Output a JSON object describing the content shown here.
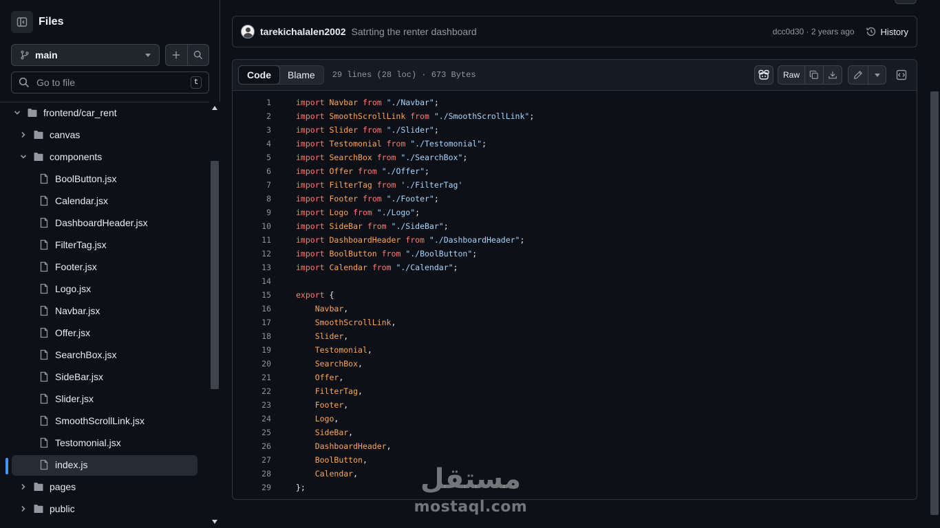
{
  "sidebar": {
    "title": "Files",
    "branch": "main",
    "search_placeholder": "Go to file",
    "shortcut_key": "t",
    "tree": [
      {
        "label": "frontend/car_rent",
        "type": "folder",
        "expanded": true,
        "depth": 0
      },
      {
        "label": "canvas",
        "type": "folder",
        "expanded": false,
        "depth": 1
      },
      {
        "label": "components",
        "type": "folder",
        "expanded": true,
        "depth": 1
      },
      {
        "label": "BoolButton.jsx",
        "type": "file",
        "depth": 2
      },
      {
        "label": "Calendar.jsx",
        "type": "file",
        "depth": 2
      },
      {
        "label": "DashboardHeader.jsx",
        "type": "file",
        "depth": 2
      },
      {
        "label": "FilterTag.jsx",
        "type": "file",
        "depth": 2
      },
      {
        "label": "Footer.jsx",
        "type": "file",
        "depth": 2
      },
      {
        "label": "Logo.jsx",
        "type": "file",
        "depth": 2
      },
      {
        "label": "Navbar.jsx",
        "type": "file",
        "depth": 2
      },
      {
        "label": "Offer.jsx",
        "type": "file",
        "depth": 2
      },
      {
        "label": "SearchBox.jsx",
        "type": "file",
        "depth": 2
      },
      {
        "label": "SideBar.jsx",
        "type": "file",
        "depth": 2
      },
      {
        "label": "Slider.jsx",
        "type": "file",
        "depth": 2
      },
      {
        "label": "SmoothScrollLink.jsx",
        "type": "file",
        "depth": 2
      },
      {
        "label": "Testomonial.jsx",
        "type": "file",
        "depth": 2
      },
      {
        "label": "index.js",
        "type": "file",
        "depth": 2,
        "active": true
      },
      {
        "label": "pages",
        "type": "folder",
        "expanded": false,
        "depth": 1
      },
      {
        "label": "public",
        "type": "folder",
        "expanded": false,
        "depth": 1
      }
    ]
  },
  "commit": {
    "author": "tarekichalalen2002",
    "message": "Satrting the renter dashboard",
    "meta": "dcc0d30 · 2 years ago",
    "history_label": "History"
  },
  "file": {
    "tab_code": "Code",
    "tab_blame": "Blame",
    "info": "29 lines (28 loc) · 673 Bytes",
    "raw_label": "Raw"
  },
  "code_lines": [
    [
      [
        "kw",
        "import"
      ],
      [
        "t",
        " "
      ],
      [
        "id",
        "Navbar"
      ],
      [
        "t",
        " "
      ],
      [
        "kw",
        "from"
      ],
      [
        "t",
        " "
      ],
      [
        "str",
        "\"./Navbar\""
      ],
      [
        "t",
        ";"
      ]
    ],
    [
      [
        "kw",
        "import"
      ],
      [
        "t",
        " "
      ],
      [
        "id",
        "SmoothScrollLink"
      ],
      [
        "t",
        " "
      ],
      [
        "kw",
        "from"
      ],
      [
        "t",
        " "
      ],
      [
        "str",
        "\"./SmoothScrollLink\""
      ],
      [
        "t",
        ";"
      ]
    ],
    [
      [
        "kw",
        "import"
      ],
      [
        "t",
        " "
      ],
      [
        "id",
        "Slider"
      ],
      [
        "t",
        " "
      ],
      [
        "kw",
        "from"
      ],
      [
        "t",
        " "
      ],
      [
        "str",
        "\"./Slider\""
      ],
      [
        "t",
        ";"
      ]
    ],
    [
      [
        "kw",
        "import"
      ],
      [
        "t",
        " "
      ],
      [
        "id",
        "Testomonial"
      ],
      [
        "t",
        " "
      ],
      [
        "kw",
        "from"
      ],
      [
        "t",
        " "
      ],
      [
        "str",
        "\"./Testomonial\""
      ],
      [
        "t",
        ";"
      ]
    ],
    [
      [
        "kw",
        "import"
      ],
      [
        "t",
        " "
      ],
      [
        "id",
        "SearchBox"
      ],
      [
        "t",
        " "
      ],
      [
        "kw",
        "from"
      ],
      [
        "t",
        " "
      ],
      [
        "str",
        "\"./SearchBox\""
      ],
      [
        "t",
        ";"
      ]
    ],
    [
      [
        "kw",
        "import"
      ],
      [
        "t",
        " "
      ],
      [
        "id",
        "Offer"
      ],
      [
        "t",
        " "
      ],
      [
        "kw",
        "from"
      ],
      [
        "t",
        " "
      ],
      [
        "str",
        "\"./Offer\""
      ],
      [
        "t",
        ";"
      ]
    ],
    [
      [
        "kw",
        "import"
      ],
      [
        "t",
        " "
      ],
      [
        "id",
        "FilterTag"
      ],
      [
        "t",
        " "
      ],
      [
        "kw",
        "from"
      ],
      [
        "t",
        " "
      ],
      [
        "str",
        "'./FilterTag'"
      ]
    ],
    [
      [
        "kw",
        "import"
      ],
      [
        "t",
        " "
      ],
      [
        "id",
        "Footer"
      ],
      [
        "t",
        " "
      ],
      [
        "kw",
        "from"
      ],
      [
        "t",
        " "
      ],
      [
        "str",
        "\"./Footer\""
      ],
      [
        "t",
        ";"
      ]
    ],
    [
      [
        "kw",
        "import"
      ],
      [
        "t",
        " "
      ],
      [
        "id",
        "Logo"
      ],
      [
        "t",
        " "
      ],
      [
        "kw",
        "from"
      ],
      [
        "t",
        " "
      ],
      [
        "str",
        "\"./Logo\""
      ],
      [
        "t",
        ";"
      ]
    ],
    [
      [
        "kw",
        "import"
      ],
      [
        "t",
        " "
      ],
      [
        "id",
        "SideBar"
      ],
      [
        "t",
        " "
      ],
      [
        "kw",
        "from"
      ],
      [
        "t",
        " "
      ],
      [
        "str",
        "\"./SideBar\""
      ],
      [
        "t",
        ";"
      ]
    ],
    [
      [
        "kw",
        "import"
      ],
      [
        "t",
        " "
      ],
      [
        "id",
        "DashboardHeader"
      ],
      [
        "t",
        " "
      ],
      [
        "kw",
        "from"
      ],
      [
        "t",
        " "
      ],
      [
        "str",
        "\"./DashboardHeader\""
      ],
      [
        "t",
        ";"
      ]
    ],
    [
      [
        "kw",
        "import"
      ],
      [
        "t",
        " "
      ],
      [
        "id",
        "BoolButton"
      ],
      [
        "t",
        " "
      ],
      [
        "kw",
        "from"
      ],
      [
        "t",
        " "
      ],
      [
        "str",
        "\"./BoolButton\""
      ],
      [
        "t",
        ";"
      ]
    ],
    [
      [
        "kw",
        "import"
      ],
      [
        "t",
        " "
      ],
      [
        "id",
        "Calendar"
      ],
      [
        "t",
        " "
      ],
      [
        "kw",
        "from"
      ],
      [
        "t",
        " "
      ],
      [
        "str",
        "\"./Calendar\""
      ],
      [
        "t",
        ";"
      ]
    ],
    [],
    [
      [
        "kw",
        "export"
      ],
      [
        "t",
        " {"
      ]
    ],
    [
      [
        "t",
        "    "
      ],
      [
        "id",
        "Navbar"
      ],
      [
        "t",
        ","
      ]
    ],
    [
      [
        "t",
        "    "
      ],
      [
        "id",
        "SmoothScrollLink"
      ],
      [
        "t",
        ","
      ]
    ],
    [
      [
        "t",
        "    "
      ],
      [
        "id",
        "Slider"
      ],
      [
        "t",
        ","
      ]
    ],
    [
      [
        "t",
        "    "
      ],
      [
        "id",
        "Testomonial"
      ],
      [
        "t",
        ","
      ]
    ],
    [
      [
        "t",
        "    "
      ],
      [
        "id",
        "SearchBox"
      ],
      [
        "t",
        ","
      ]
    ],
    [
      [
        "t",
        "    "
      ],
      [
        "id",
        "Offer"
      ],
      [
        "t",
        ","
      ]
    ],
    [
      [
        "t",
        "    "
      ],
      [
        "id",
        "FilterTag"
      ],
      [
        "t",
        ","
      ]
    ],
    [
      [
        "t",
        "    "
      ],
      [
        "id",
        "Footer"
      ],
      [
        "t",
        ","
      ]
    ],
    [
      [
        "t",
        "    "
      ],
      [
        "id",
        "Logo"
      ],
      [
        "t",
        ","
      ]
    ],
    [
      [
        "t",
        "    "
      ],
      [
        "id",
        "SideBar"
      ],
      [
        "t",
        ","
      ]
    ],
    [
      [
        "t",
        "    "
      ],
      [
        "id",
        "DashboardHeader"
      ],
      [
        "t",
        ","
      ]
    ],
    [
      [
        "t",
        "    "
      ],
      [
        "id",
        "BoolButton"
      ],
      [
        "t",
        ","
      ]
    ],
    [
      [
        "t",
        "    "
      ],
      [
        "id",
        "Calendar"
      ],
      [
        "t",
        ","
      ]
    ],
    [
      [
        "t",
        "};"
      ]
    ]
  ],
  "watermark": {
    "arabic": "مستقل",
    "latin": "mostaql.com"
  }
}
